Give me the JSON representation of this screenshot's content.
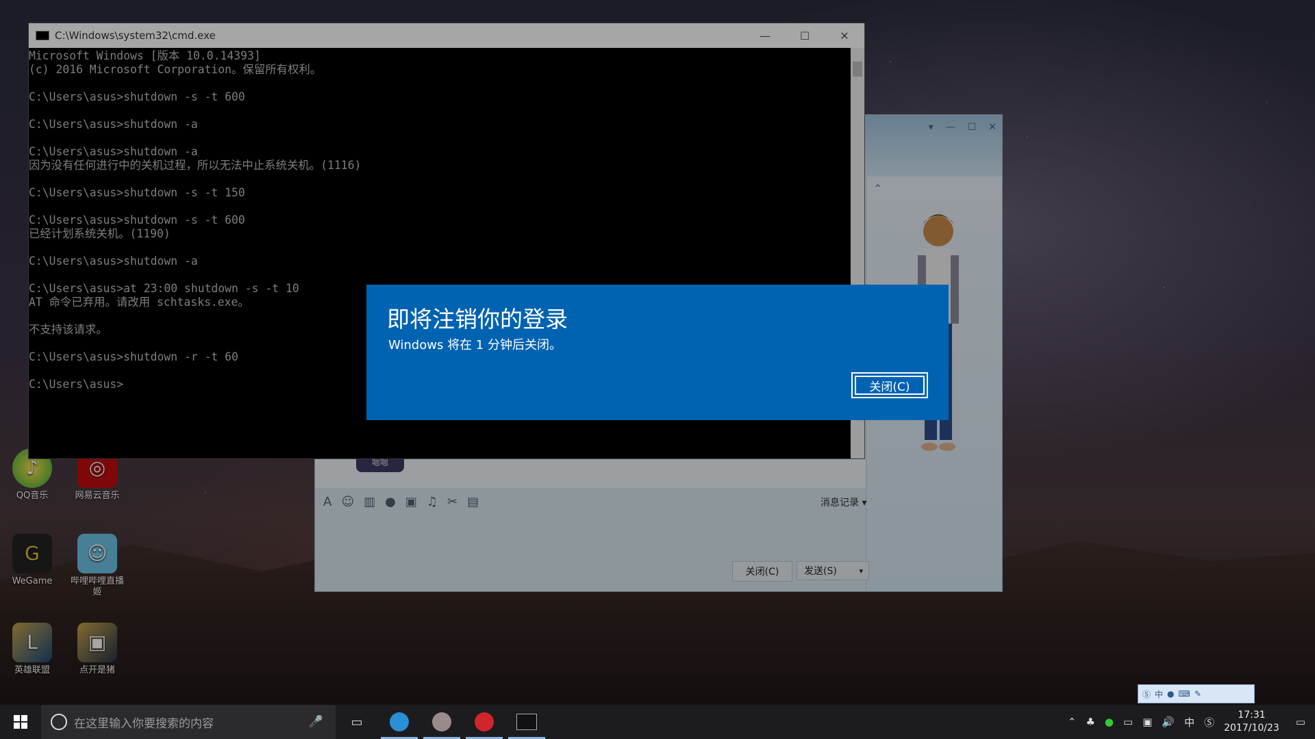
{
  "desktop_icons": [
    {
      "label": "QQ音乐",
      "icon": "qq-music-icon"
    },
    {
      "label": "网易云音乐",
      "icon": "netease-music-icon"
    },
    {
      "label": "WeGame",
      "icon": "wegame-icon"
    },
    {
      "label": "哔哩哔哩直播姬",
      "icon": "bilibili-live-icon"
    },
    {
      "label": "英雄联盟",
      "icon": "lol-icon"
    },
    {
      "label": "点开是猪",
      "icon": "shortcut-icon"
    }
  ],
  "cmd": {
    "title": "C:\\Windows\\system32\\cmd.exe",
    "lines": "Microsoft Windows [版本 10.0.14393]\n(c) 2016 Microsoft Corporation。保留所有权利。\n\nC:\\Users\\asus>shutdown -s -t 600\n\nC:\\Users\\asus>shutdown -a\n\nC:\\Users\\asus>shutdown -a\n因为没有任何进行中的关机过程，所以无法中止系统关机。(1116)\n\nC:\\Users\\asus>shutdown -s -t 150\n\nC:\\Users\\asus>shutdown -s -t 600\n已经计划系统关机。(1190)\n\nC:\\Users\\asus>shutdown -a\n\nC:\\Users\\asus>at 23:00 shutdown -s -t 10\nAT 命令已弃用。请改用 schtasks.exe。\n\n不支持该请求。\n\nC:\\Users\\asus>shutdown -r -t 60\n\nC:\\Users\\asus>"
  },
  "dialog": {
    "title": "即将注销你的登录",
    "message": "Windows 将在 1 分钟后关闭。",
    "close_label": "关闭(C)"
  },
  "qq": {
    "history_label": "消息记录",
    "close_label": "关闭(C)",
    "send_label": "发送(S)",
    "bubble_text": "嗯嗯"
  },
  "taskbar": {
    "search_placeholder": "在这里输入你要搜索的内容",
    "time": "17:31",
    "date": "2017/10/23",
    "ime": "中"
  },
  "colors": {
    "dialog_blue": "#0063b1",
    "taskbar": "#1c1c1e"
  }
}
